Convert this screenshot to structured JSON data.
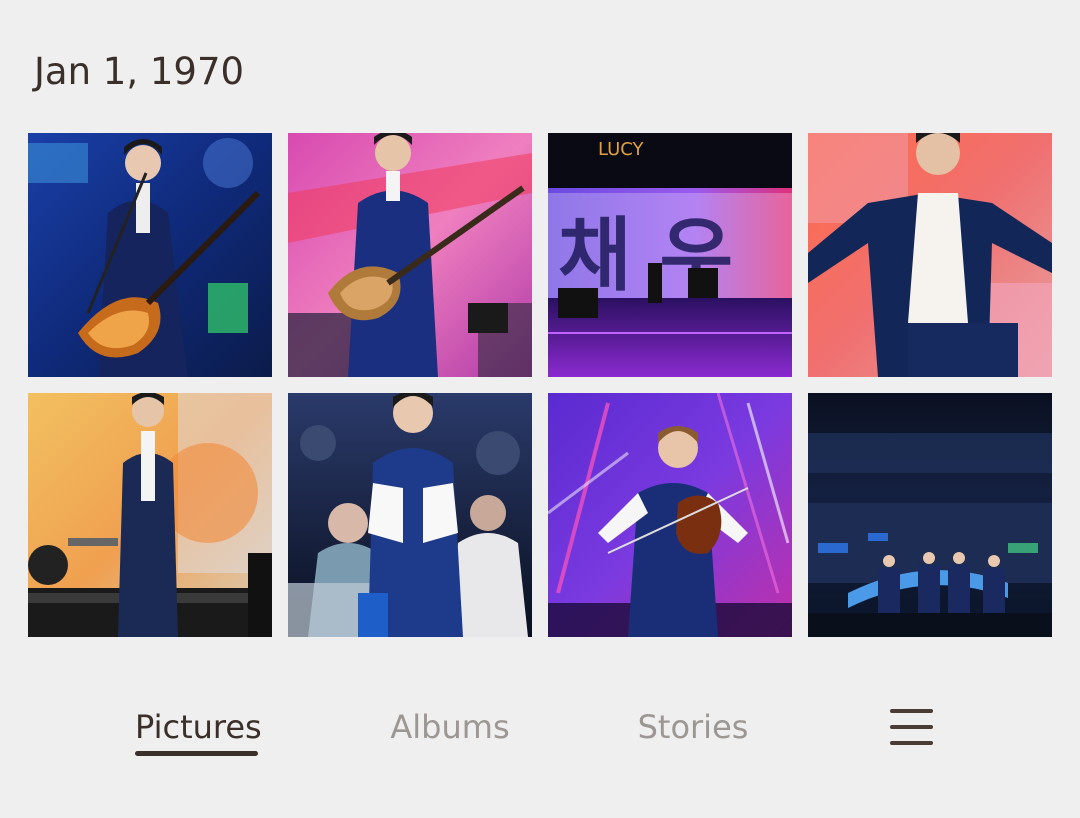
{
  "header": {
    "date": "Jan 1, 1970"
  },
  "photos": [
    {
      "subject": "guitarist-singing-at-mic"
    },
    {
      "subject": "bass-player-pink-screen"
    },
    {
      "subject": "stage-with-korean-text-screen",
      "screen_text": "LUCY",
      "screen_big_text": "채 우"
    },
    {
      "subject": "singer-arms-outstretched"
    },
    {
      "subject": "singer-walking-on-stage"
    },
    {
      "subject": "singer-with-crowd"
    },
    {
      "subject": "violinist-purple-lights"
    },
    {
      "subject": "band-with-audience-banners"
    }
  ],
  "bottom_nav": {
    "tabs": [
      {
        "label": "Pictures",
        "active": true
      },
      {
        "label": "Albums",
        "active": false
      },
      {
        "label": "Stories",
        "active": false
      }
    ],
    "menu_icon": "hamburger-menu-icon"
  },
  "colors": {
    "background": "#efefef",
    "active_text": "#3b2f2a",
    "inactive_text": "#9d9793"
  }
}
